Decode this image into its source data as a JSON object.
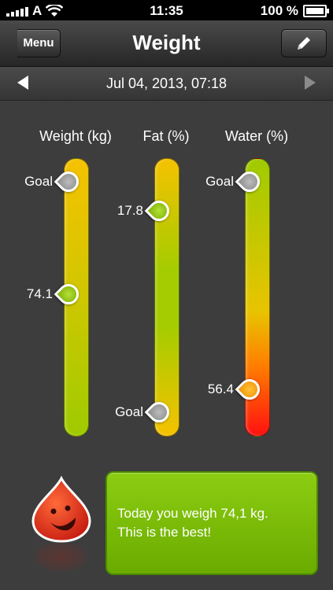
{
  "status_bar": {
    "carrier": "A",
    "time": "11:35",
    "battery": "100 %"
  },
  "nav": {
    "title": "Weight",
    "menu_label": "Menu",
    "edit_icon": "pencil-icon"
  },
  "date_bar": {
    "date": "Jul 04, 2013, 07:18"
  },
  "columns": [
    {
      "label": "Weight (kg)",
      "current_value": "74.1",
      "goal_label": "Goal"
    },
    {
      "label": "Fat (%)",
      "current_value": "17.8",
      "goal_label": "Goal"
    },
    {
      "label": "Water (%)",
      "current_value": "56.4",
      "goal_label": "Goal"
    }
  ],
  "message": {
    "line1": "Today you weigh 74,1 kg.",
    "line2": "This is the best!"
  },
  "colors": {
    "accent_green": "#7ab800",
    "mascot_red": "#d62a1a",
    "bar_red": "#ff1010",
    "bar_yellow": "#f5c200"
  }
}
